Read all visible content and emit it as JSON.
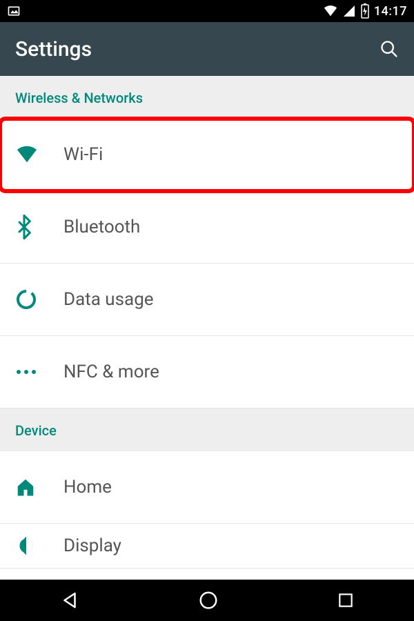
{
  "statusBar": {
    "time": "14:17"
  },
  "appBar": {
    "title": "Settings"
  },
  "sections": {
    "wireless": {
      "header": "Wireless & Networks",
      "items": {
        "wifi": "Wi-Fi",
        "bluetooth": "Bluetooth",
        "dataUsage": "Data usage",
        "nfcMore": "NFC & more"
      }
    },
    "device": {
      "header": "Device",
      "items": {
        "home": "Home",
        "display": "Display"
      }
    }
  },
  "colors": {
    "accent": "#00897b",
    "appBar": "#37474f",
    "highlight": "#ff0000"
  }
}
